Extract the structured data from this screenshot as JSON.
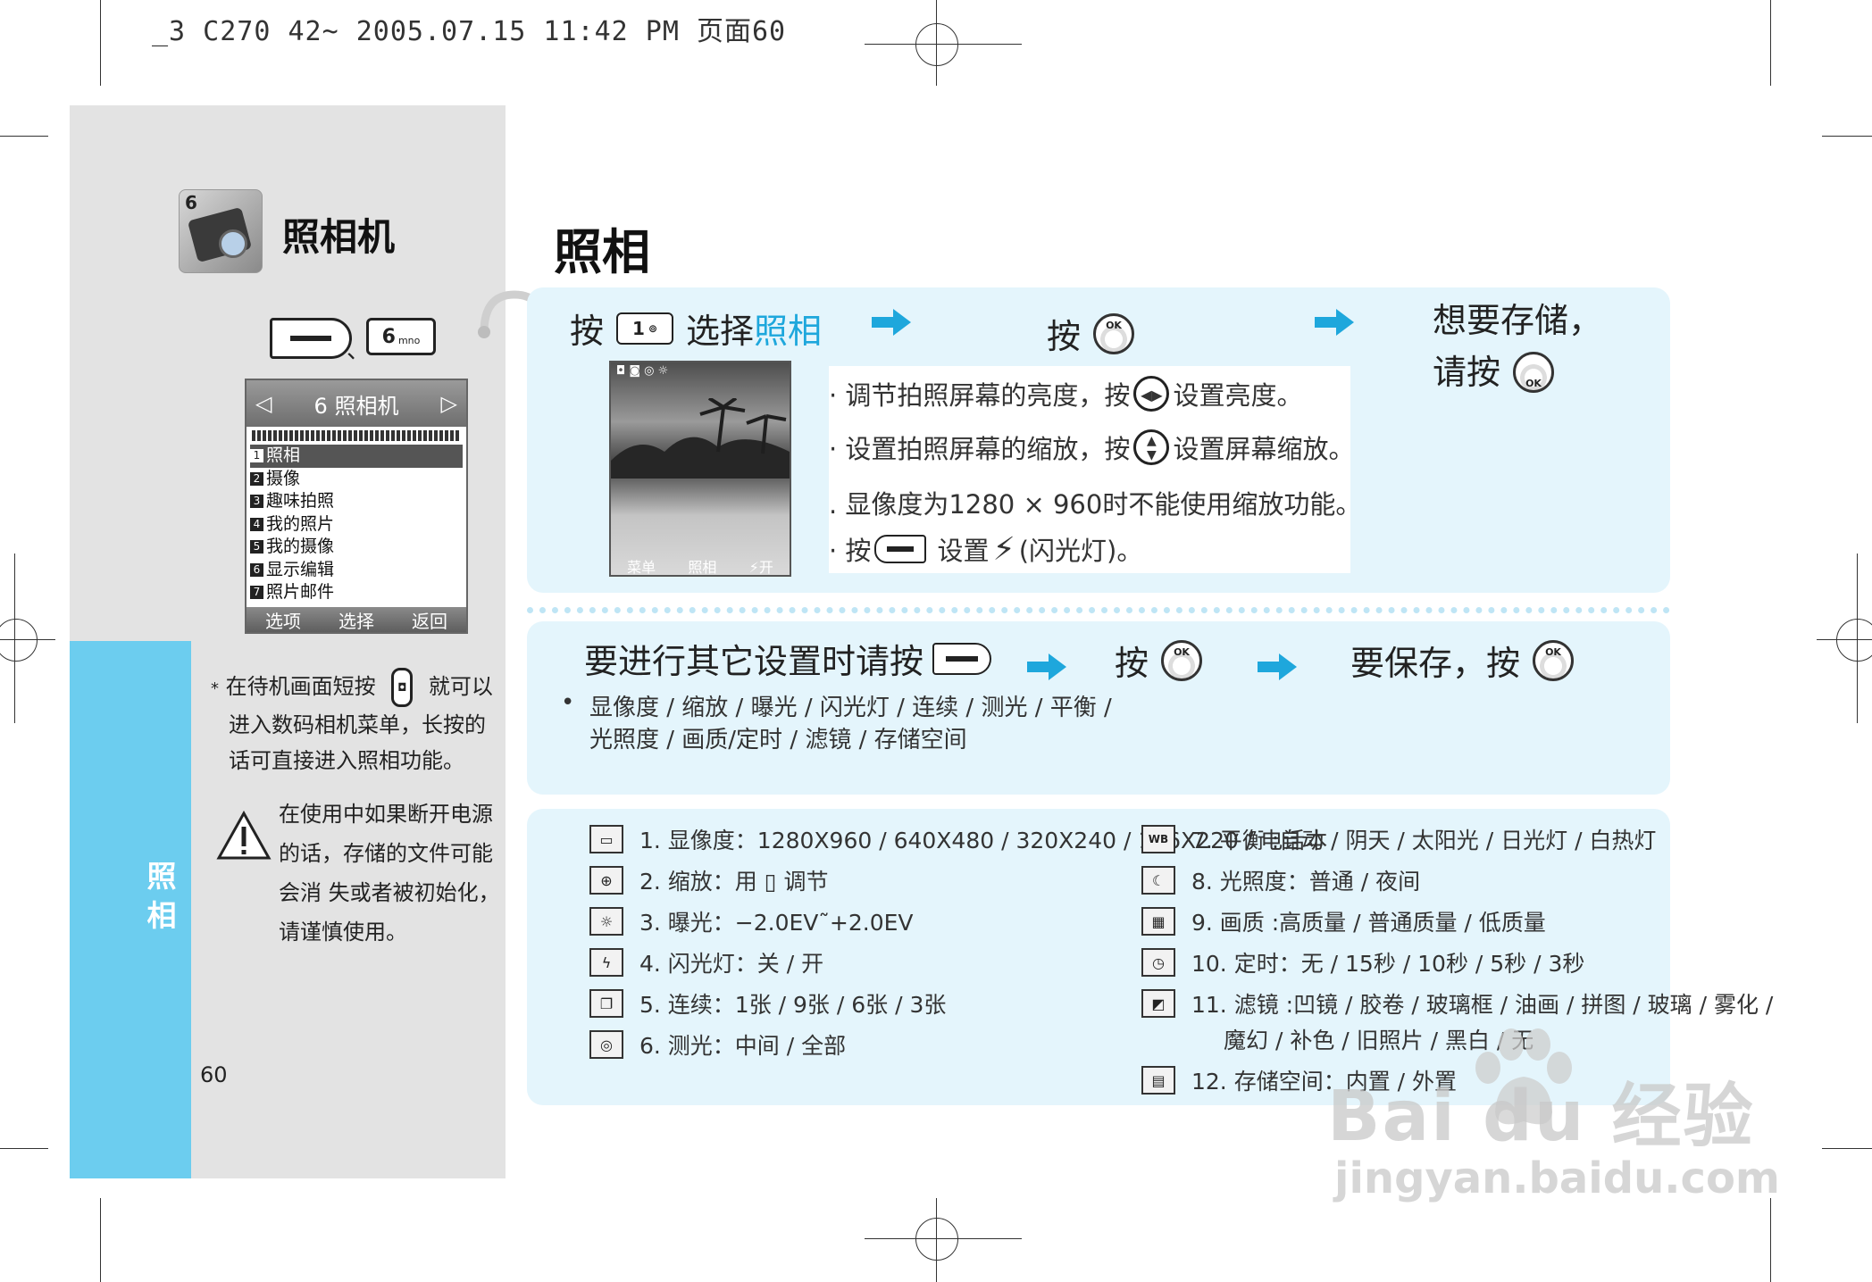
{
  "header": {
    "printer_line": "_3 C270 42~ 2005.07.15 11:42 PM 页面60"
  },
  "sidebar": {
    "app_number": "6",
    "app_title": "照相机",
    "key_sep": "、",
    "key_6_label": "6",
    "key_6_sub": "mno",
    "tab_label": "照相",
    "page_number": "60"
  },
  "phone_menu": {
    "header": "6 照相机",
    "items": [
      {
        "num": "1",
        "label": "照相"
      },
      {
        "num": "2",
        "label": "摄像"
      },
      {
        "num": "3",
        "label": "趣味拍照"
      },
      {
        "num": "4",
        "label": "我的照片"
      },
      {
        "num": "5",
        "label": "我的摄像"
      },
      {
        "num": "6",
        "label": "显示编辑"
      },
      {
        "num": "7",
        "label": "照片邮件"
      }
    ],
    "softkeys": [
      "选项",
      "选择",
      "返回"
    ]
  },
  "notes": {
    "tip_star": "*",
    "tip_line1a": "在待机画面短按",
    "tip_line1b": "就可以",
    "tip_line2": "进入数码相机菜单，长按的",
    "tip_line3": "话可直接进入照相功能。",
    "warning_lines": [
      "在使用中如果断开电源",
      "的话，存储的文件可能",
      "会消 失或者被初始化，",
      "请谨慎使用。"
    ]
  },
  "main": {
    "title": "照相",
    "step1": {
      "press": "按",
      "key": "1",
      "select": "选择",
      "target": "照相"
    },
    "step2": {
      "press": "按"
    },
    "step3": {
      "line1": "想要存储，",
      "line2": "请按"
    },
    "camera_screen": {
      "status_icons": "◘ ◙ ◎ ☼",
      "softkeys": [
        "菜单",
        "照相",
        "⚡开"
      ]
    },
    "tips": {
      "t1a": "· 调节拍照屏幕的亮度，按",
      "t1b": "设置亮度。",
      "t2a": "· 设置拍照屏幕的缩放，按",
      "t2b": "设置屏幕缩放。",
      "t3": ". 显像度为1280 × 960时不能使用缩放功能。",
      "t4a": "· 按",
      "t4b": "设置",
      "t4c": "(闪光灯)。"
    },
    "other": {
      "press_settings": "要进行其它设置时请按",
      "press": "按",
      "save": "要保存，按",
      "bullet": "•",
      "list_line1": "显像度 / 缩放 / 曝光 / 闪光灯 / 连续 / 测光 / 平衡 /",
      "list_line2": "光照度 / 画质/定时 / 滤镜 / 存储空间"
    },
    "settings_left": [
      {
        "icon": "res-icon",
        "glyph": "▭",
        "text": "1. 显像度：1280X960 / 640X480 / 320X240 / 176X220 / 电话本"
      },
      {
        "icon": "zoom-icon",
        "glyph": "⊕",
        "text": "2. 缩放：用 ▯ 调节"
      },
      {
        "icon": "exposure-icon",
        "glyph": "☼",
        "text": "3. 曝光：−2.0EV˜+2.0EV"
      },
      {
        "icon": "flash-icon",
        "glyph": "ϟ",
        "text": "4. 闪光灯：关 / 开"
      },
      {
        "icon": "burst-icon",
        "glyph": "❐",
        "text": "5. 连续：1张 / 9张 / 6张 / 3张"
      },
      {
        "icon": "metering-icon",
        "glyph": "◎",
        "text": "6. 测光：中间 / 全部"
      }
    ],
    "settings_right": [
      {
        "icon": "wb-icon",
        "glyph": "WB",
        "text": "7. 平衡 :自动 / 阴天 / 太阳光 / 日光灯 / 白热灯"
      },
      {
        "icon": "night-icon",
        "glyph": "☾",
        "text": "8. 光照度：普通 / 夜间"
      },
      {
        "icon": "quality-icon",
        "glyph": "▦",
        "text": "9. 画质 :高质量 / 普通质量 / 低质量"
      },
      {
        "icon": "timer-icon",
        "glyph": "◷",
        "text": "10. 定时：无 / 15秒 / 10秒 / 5秒 / 3秒"
      },
      {
        "icon": "filter-icon",
        "glyph": "◩",
        "text": "11. 滤镜 :凹镜 / 胶卷 / 玻璃框 / 油画 / 拼图 / 玻璃 / 雾化 /",
        "cont": "魔幻 / 补色 /  旧照片 / 黑白 / 无"
      },
      {
        "icon": "storage-icon",
        "glyph": "▤",
        "text": "12. 存储空间：内置 / 外置"
      }
    ]
  },
  "watermark": {
    "logo": "Bai du 经验",
    "url": "jingyan.baidu.com"
  }
}
